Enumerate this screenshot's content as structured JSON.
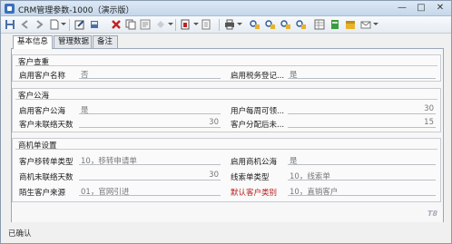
{
  "window": {
    "title": "CRM管理参数-1000（演示版）",
    "min_glyph": "—",
    "max_glyph": "□",
    "close_glyph": "✕"
  },
  "toolbar": {
    "icons": [
      "save-icon",
      "back-icon",
      "forward-icon",
      "new-icon",
      "edit-icon",
      "delete-icon",
      "copy-icon",
      "properties-icon",
      "undo-icon",
      "filter-icon",
      "print-icon",
      "link-icon",
      "link-add-icon",
      "link-remove-icon",
      "report-icon",
      "table-icon",
      "export-icon",
      "mail-icon",
      "close-icon"
    ]
  },
  "tabs": [
    {
      "label": "基本信息",
      "active": true
    },
    {
      "label": "管理数据",
      "active": false
    },
    {
      "label": "备注",
      "active": false
    }
  ],
  "groups": {
    "customer_check": {
      "title": "客户查重",
      "fields": [
        {
          "label": "启用客户名称",
          "value": "否"
        },
        {
          "label": "启用税务登记...",
          "value": "是"
        }
      ]
    },
    "customer_pool": {
      "title": "客户公海",
      "fields": [
        {
          "label": "启用客户公海",
          "value": "是"
        },
        {
          "label": "用户每周可领...",
          "value": "30"
        },
        {
          "label": "客户未联络天数",
          "value": "30"
        },
        {
          "label": "客户分配后未...",
          "value": "15"
        }
      ]
    },
    "opportunity": {
      "title": "商机单设置",
      "fields": [
        {
          "label": "客户移转单类型",
          "value": "10，移转申请单"
        },
        {
          "label": "启用商机公海",
          "value": "是"
        },
        {
          "label": "商机未联络天数",
          "value": "30"
        },
        {
          "label": "线索单类型",
          "value": "10，线索单"
        },
        {
          "label": "陌生客户来源",
          "value": "01，官网引进"
        },
        {
          "label": "默认客户类别",
          "value": "10，直销客户"
        }
      ]
    }
  },
  "status": {
    "text": "已确认"
  },
  "watermark": "T8",
  "colors": {
    "required_label": "#b81c1c",
    "title_bar": "#c6d7ea"
  }
}
